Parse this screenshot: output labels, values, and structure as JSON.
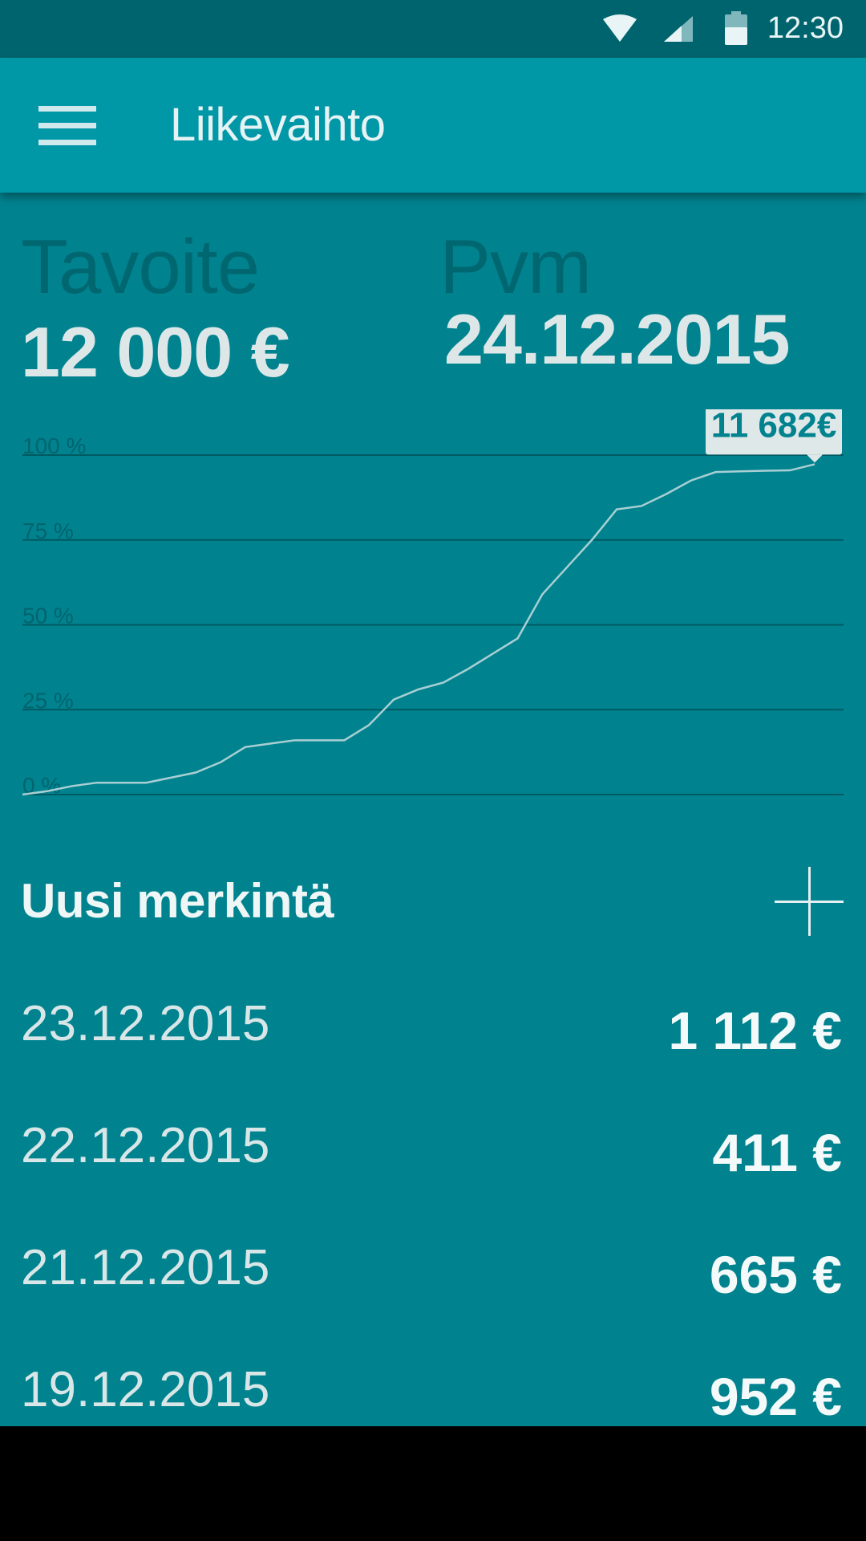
{
  "status_bar": {
    "time": "12:30",
    "icons": [
      "wifi-icon",
      "cell-signal-icon",
      "battery-icon"
    ]
  },
  "toolbar": {
    "title": "Liikevaihto",
    "menu_icon": "hamburger-menu-icon"
  },
  "summary": {
    "goal_label": "Tavoite",
    "goal_value": "12 000 €",
    "date_label": "Pvm",
    "date_value": "24.12.2015"
  },
  "chart_data": {
    "type": "line",
    "y_ticks": [
      "100 %",
      "75 %",
      "50 %",
      "25 %",
      "0 %"
    ],
    "ylim": [
      0,
      100
    ],
    "grid": true,
    "callout_label": "11 682€",
    "series": [
      {
        "values": [
          0,
          1,
          2.5,
          3.5,
          3.5,
          3.5,
          5,
          6.5,
          9.5,
          14,
          15,
          16,
          16,
          16,
          20.5,
          28,
          31,
          33,
          37,
          41.5,
          46,
          59,
          67,
          75,
          84,
          85,
          88.5,
          92.5,
          95,
          95.2,
          95.4,
          95.5,
          97.3
        ]
      }
    ],
    "colors": {
      "line": "#a9cfd3",
      "grid": "#005a62",
      "callout_bg": "#dfe8e9",
      "callout_text": "#00838f"
    }
  },
  "new_entry": {
    "label": "Uusi merkintä",
    "add_icon": "plus-icon"
  },
  "entries": [
    {
      "date": "23.12.2015",
      "amount": "1 112 €"
    },
    {
      "date": "22.12.2015",
      "amount": "411 €"
    },
    {
      "date": "21.12.2015",
      "amount": "665 €"
    },
    {
      "date": "19.12.2015",
      "amount": "952 €"
    }
  ],
  "colors": {
    "status_bar": "#00646e",
    "toolbar": "#0097a7",
    "background": "#00838f"
  }
}
